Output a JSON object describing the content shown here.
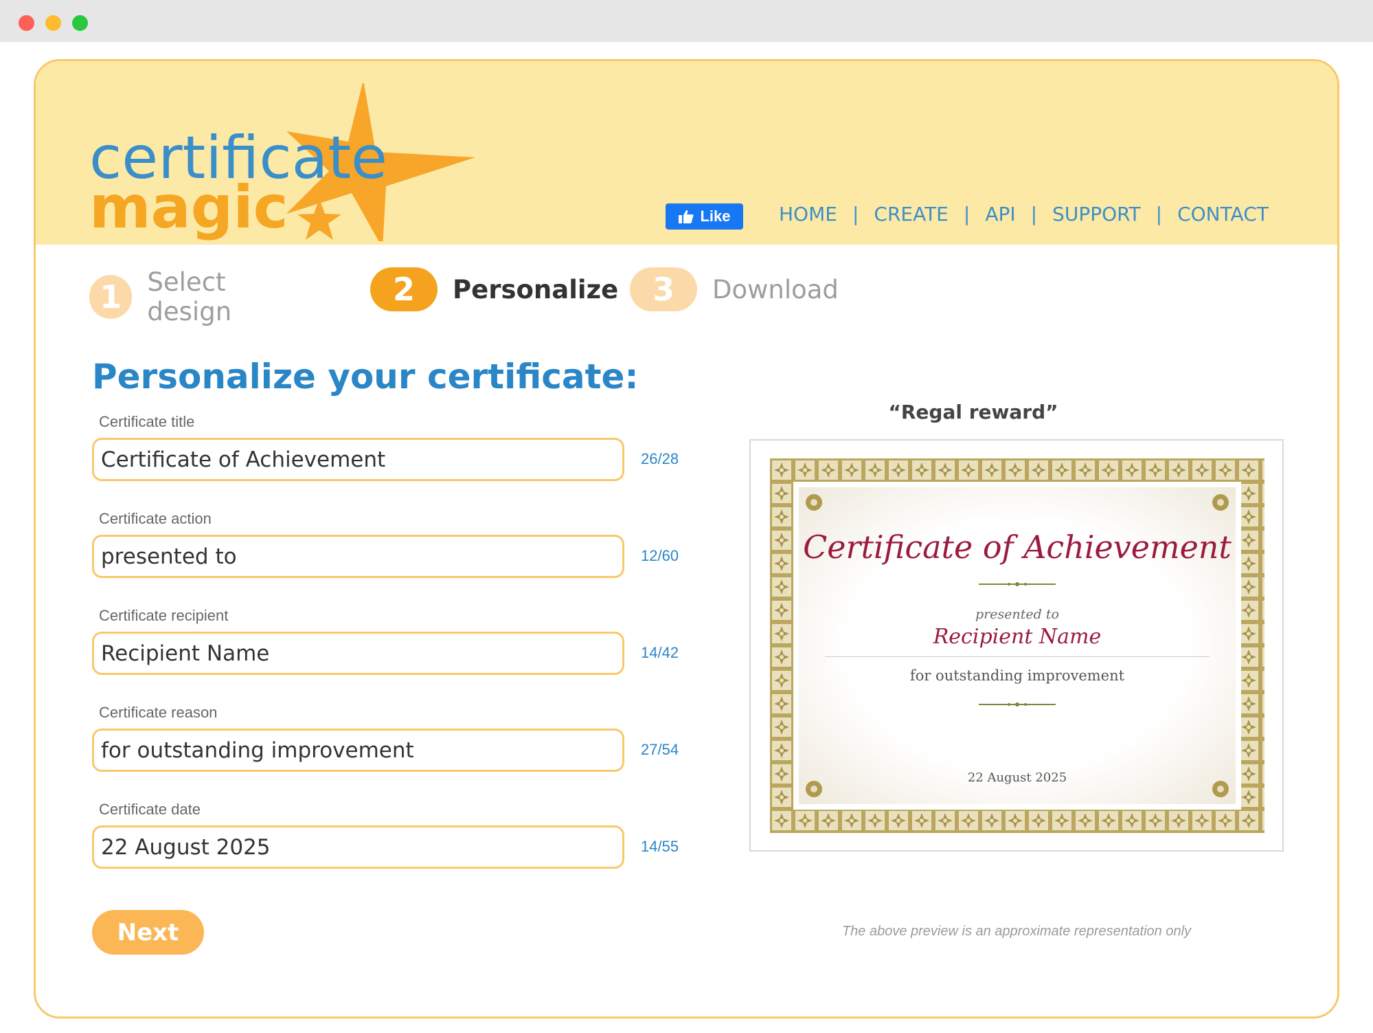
{
  "header": {
    "logo_line1": "certificate",
    "logo_line2": "magic",
    "like_label": "Like",
    "nav": [
      "HOME",
      "CREATE",
      "API",
      "SUPPORT",
      "CONTACT"
    ]
  },
  "steps": [
    {
      "number": "1",
      "label": "Select design",
      "active": false
    },
    {
      "number": "2",
      "label": "Personalize",
      "active": true
    },
    {
      "number": "3",
      "label": "Download",
      "active": false
    }
  ],
  "form": {
    "heading": "Personalize your certificate:",
    "fields": [
      {
        "label": "Certificate title",
        "value": "Certificate of Achievement",
        "count": "26/28"
      },
      {
        "label": "Certificate action",
        "value": "presented to",
        "count": "12/60"
      },
      {
        "label": "Certificate recipient",
        "value": "Recipient Name",
        "count": "14/42"
      },
      {
        "label": "Certificate reason",
        "value": "for outstanding improvement",
        "count": "27/54"
      },
      {
        "label": "Certificate date",
        "value": "22 August 2025",
        "count": "14/55"
      }
    ],
    "next_label": "Next"
  },
  "preview": {
    "title": "“Regal reward”",
    "cert_title": "Certificate of Achievement",
    "cert_action": "presented to",
    "cert_recipient": "Recipient Name",
    "cert_reason": "for outstanding improvement",
    "cert_date": "22 August 2025",
    "disclaimer": "The above preview is an approximate representation only"
  },
  "colors": {
    "header_bg": "#fde9a6",
    "accent_orange": "#f5a21f",
    "link_blue": "#3b8fc9",
    "border_gold": "#f9c86a",
    "cert_red": "#9b1b3d",
    "cert_gold": "#b8a25a"
  }
}
